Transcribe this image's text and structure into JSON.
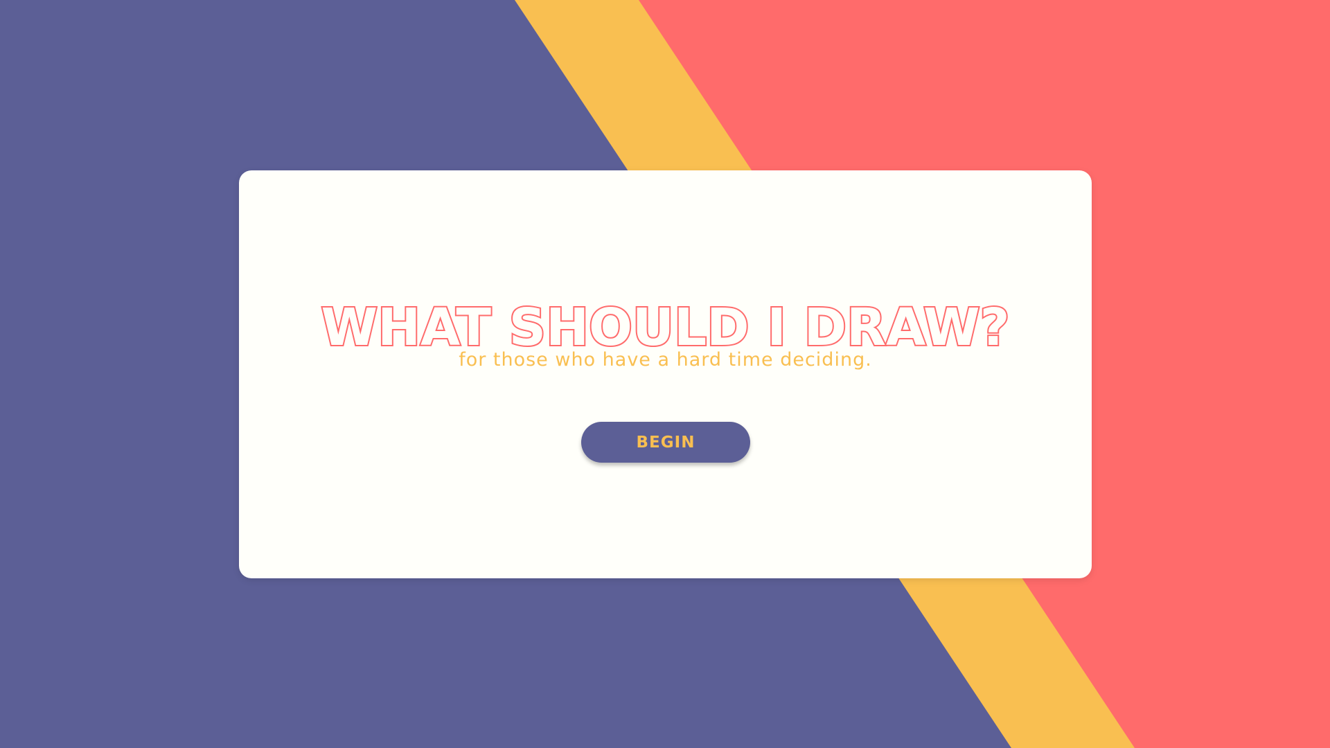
{
  "colors": {
    "navy": "#5c5f96",
    "yellow": "#f9bf51",
    "coral": "#ff6b6b",
    "card": "#fffffa"
  },
  "hero": {
    "title": "WHAT SHOULD I DRAW?",
    "subtitle": "for those who have a hard time deciding."
  },
  "actions": {
    "begin_label": "BEGIN"
  }
}
